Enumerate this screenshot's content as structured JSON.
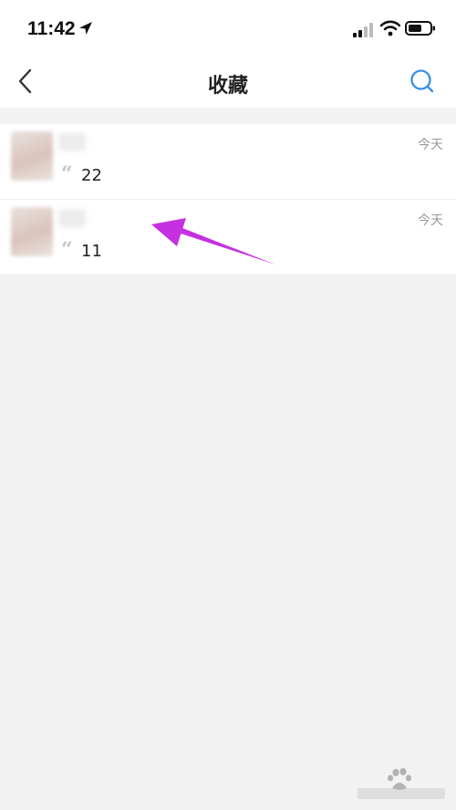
{
  "status_bar": {
    "time": "11:42",
    "icons": [
      "location-arrow-icon",
      "signal-icon",
      "wifi-icon",
      "battery-icon"
    ]
  },
  "nav": {
    "title": "收藏",
    "back_icon": "chevron-left-icon",
    "search_icon": "search-icon"
  },
  "colors": {
    "accent": "#3a8ee6",
    "annotation": "#c531e0",
    "background": "#f2f2f2",
    "surface": "#ffffff"
  },
  "favorites": [
    {
      "message": "22",
      "time": "今天"
    },
    {
      "message": "11",
      "time": "今天"
    }
  ]
}
